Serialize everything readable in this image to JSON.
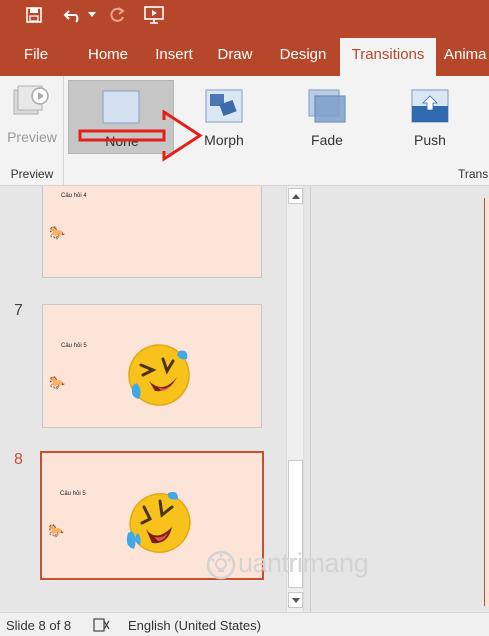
{
  "tabs": [
    {
      "label": "File"
    },
    {
      "label": "Home"
    },
    {
      "label": "Insert"
    },
    {
      "label": "Draw"
    },
    {
      "label": "Design"
    },
    {
      "label": "Transitions"
    },
    {
      "label": "Anima"
    }
  ],
  "active_tab": "Transitions",
  "quick_access": {
    "icons": [
      "save-icon",
      "undo-icon",
      "dropdown-icon",
      "redo-icon",
      "present-icon"
    ]
  },
  "ribbon": {
    "preview_button": "Preview",
    "preview_group": "Preview",
    "transitions_group": "Trans",
    "gallery": [
      {
        "label": "None",
        "selected": true
      },
      {
        "label": "Morph",
        "selected": false
      },
      {
        "label": "Fade",
        "selected": false
      },
      {
        "label": "Push",
        "selected": false
      }
    ]
  },
  "slides": [
    {
      "number": "",
      "title": "Câu hỏi 4",
      "has_emoji": false,
      "selected": false
    },
    {
      "number": "7",
      "title": "Câu hỏi 5",
      "has_emoji": true,
      "selected": false
    },
    {
      "number": "8",
      "title": "Câu hỏi 5",
      "has_emoji": true,
      "selected": true
    }
  ],
  "status_bar": {
    "slide_info": "Slide 8 of 8",
    "language": "English (United States)"
  },
  "watermark": "uantrimang",
  "colors": {
    "brand": "#b7472a",
    "selection": "#c8502e",
    "slide_bg": "#fde4d8",
    "annotation": "#e32119"
  }
}
